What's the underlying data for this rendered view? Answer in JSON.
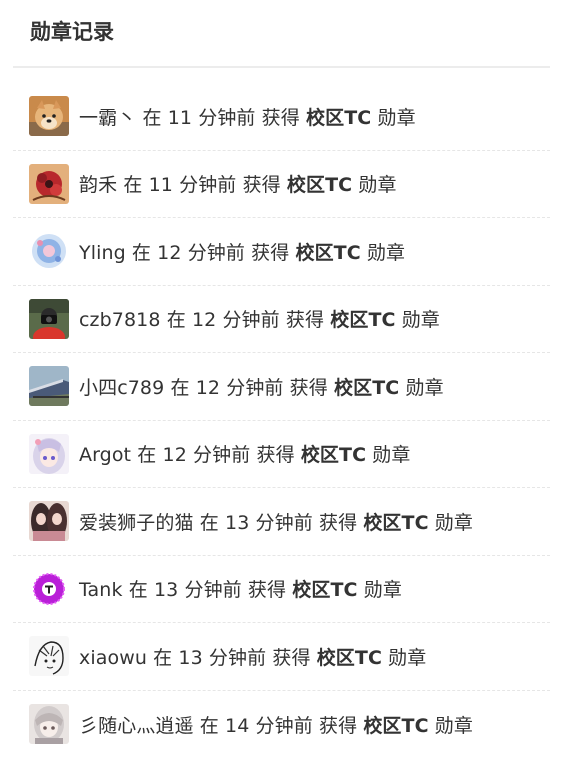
{
  "panel": {
    "title": "勋章记录"
  },
  "records": [
    {
      "user": "一霸丶",
      "in": "在",
      "time": "11 分钟前",
      "obtain": "获得",
      "badge": "校区TC",
      "unit": "勋章",
      "avatar": "dog-avatar"
    },
    {
      "user": "韵禾",
      "in": "在",
      "time": "11 分钟前",
      "obtain": "获得",
      "badge": "校区TC",
      "unit": "勋章",
      "avatar": "red-flower-avatar"
    },
    {
      "user": "Yling",
      "in": "在",
      "time": "12 分钟前",
      "obtain": "获得",
      "badge": "校区TC",
      "unit": "勋章",
      "avatar": "blue-circle-avatar"
    },
    {
      "user": "czb7818",
      "in": "在",
      "time": "12 分钟前",
      "obtain": "获得",
      "badge": "校区TC",
      "unit": "勋章",
      "avatar": "photographer-avatar"
    },
    {
      "user": "小四c789",
      "in": "在",
      "time": "12 分钟前",
      "obtain": "获得",
      "badge": "校区TC",
      "unit": "勋章",
      "avatar": "train-avatar"
    },
    {
      "user": "Argot",
      "in": "在",
      "time": "12 分钟前",
      "obtain": "获得",
      "badge": "校区TC",
      "unit": "勋章",
      "avatar": "anime-girl-avatar"
    },
    {
      "user": "爱装狮子的猫",
      "in": "在",
      "time": "13 分钟前",
      "obtain": "获得",
      "badge": "校区TC",
      "unit": "勋章",
      "avatar": "two-girls-avatar"
    },
    {
      "user": "Tank",
      "in": "在",
      "time": "13 分钟前",
      "obtain": "获得",
      "badge": "校区TC",
      "unit": "勋章",
      "avatar": "purple-t-avatar"
    },
    {
      "user": "xiaowu",
      "in": "在",
      "time": "13 分钟前",
      "obtain": "获得",
      "badge": "校区TC",
      "unit": "勋章",
      "avatar": "sketch-avatar"
    },
    {
      "user": "彡随心灬逍遥",
      "in": "在",
      "time": "14 分钟前",
      "obtain": "获得",
      "badge": "校区TC",
      "unit": "勋章",
      "avatar": "pale-girl-avatar"
    }
  ]
}
